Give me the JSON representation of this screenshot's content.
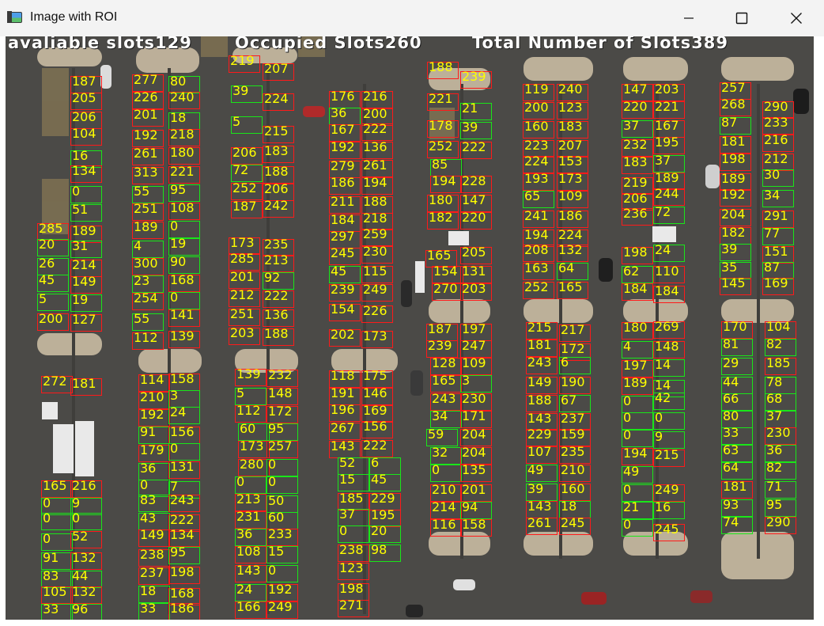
{
  "window": {
    "title": "Image with ROI"
  },
  "overlay": {
    "available": "avaliable slots129",
    "occupied": "Occupied Slots260",
    "total": "Total Number of Slots389"
  },
  "slots": [
    {
      "n": "187",
      "s": "occ"
    },
    {
      "n": "205",
      "s": "occ"
    },
    {
      "n": "206",
      "s": "occ"
    },
    {
      "n": "104",
      "s": "occ"
    },
    {
      "n": "16",
      "s": "free"
    },
    {
      "n": "134",
      "s": "occ"
    },
    {
      "n": "0",
      "s": "free"
    },
    {
      "n": "51",
      "s": "free"
    },
    {
      "n": "285",
      "s": "occ"
    },
    {
      "n": "189",
      "s": "occ"
    },
    {
      "n": "20",
      "s": "free"
    },
    {
      "n": "31",
      "s": "free"
    },
    {
      "n": "26",
      "s": "free"
    },
    {
      "n": "214",
      "s": "occ"
    },
    {
      "n": "45",
      "s": "free"
    },
    {
      "n": "149",
      "s": "occ"
    },
    {
      "n": "5",
      "s": "free"
    },
    {
      "n": "19",
      "s": "free"
    },
    {
      "n": "200",
      "s": "occ"
    },
    {
      "n": "127",
      "s": "occ"
    },
    {
      "n": "272",
      "s": "occ"
    },
    {
      "n": "181",
      "s": "occ"
    },
    {
      "n": "165",
      "s": "occ"
    },
    {
      "n": "216",
      "s": "occ"
    },
    {
      "n": "0",
      "s": "free"
    },
    {
      "n": "9",
      "s": "free"
    },
    {
      "n": "0",
      "s": "free"
    },
    {
      "n": "0",
      "s": "free"
    },
    {
      "n": "0",
      "s": "free"
    },
    {
      "n": "52",
      "s": "occ"
    },
    {
      "n": "91",
      "s": "free"
    },
    {
      "n": "132",
      "s": "occ"
    },
    {
      "n": "83",
      "s": "free"
    },
    {
      "n": "44",
      "s": "free"
    },
    {
      "n": "105",
      "s": "occ"
    },
    {
      "n": "132",
      "s": "occ"
    },
    {
      "n": "33",
      "s": "free"
    },
    {
      "n": "96",
      "s": "free"
    },
    {
      "n": "277",
      "s": "occ"
    },
    {
      "n": "80",
      "s": "free"
    },
    {
      "n": "226",
      "s": "occ"
    },
    {
      "n": "240",
      "s": "occ"
    },
    {
      "n": "201",
      "s": "occ"
    },
    {
      "n": "18",
      "s": "free"
    },
    {
      "n": "192",
      "s": "occ"
    },
    {
      "n": "218",
      "s": "occ"
    },
    {
      "n": "261",
      "s": "occ"
    },
    {
      "n": "180",
      "s": "occ"
    },
    {
      "n": "313",
      "s": "occ"
    },
    {
      "n": "221",
      "s": "occ"
    },
    {
      "n": "55",
      "s": "free"
    },
    {
      "n": "95",
      "s": "free"
    },
    {
      "n": "251",
      "s": "occ"
    },
    {
      "n": "108",
      "s": "occ"
    },
    {
      "n": "189",
      "s": "occ"
    },
    {
      "n": "0",
      "s": "free"
    },
    {
      "n": "4",
      "s": "free"
    },
    {
      "n": "19",
      "s": "free"
    },
    {
      "n": "300",
      "s": "occ"
    },
    {
      "n": "90",
      "s": "free"
    },
    {
      "n": "23",
      "s": "free"
    },
    {
      "n": "168",
      "s": "occ"
    },
    {
      "n": "254",
      "s": "occ"
    },
    {
      "n": "0",
      "s": "free"
    },
    {
      "n": "55",
      "s": "free"
    },
    {
      "n": "141",
      "s": "occ"
    },
    {
      "n": "112",
      "s": "occ"
    },
    {
      "n": "139",
      "s": "occ"
    },
    {
      "n": "114",
      "s": "occ"
    },
    {
      "n": "158",
      "s": "occ"
    },
    {
      "n": "210",
      "s": "occ"
    },
    {
      "n": "3",
      "s": "free"
    },
    {
      "n": "192",
      "s": "occ"
    },
    {
      "n": "24",
      "s": "free"
    },
    {
      "n": "91",
      "s": "free"
    },
    {
      "n": "156",
      "s": "occ"
    },
    {
      "n": "179",
      "s": "occ"
    },
    {
      "n": "0",
      "s": "free"
    },
    {
      "n": "36",
      "s": "free"
    },
    {
      "n": "131",
      "s": "occ"
    },
    {
      "n": "0",
      "s": "free"
    },
    {
      "n": "7",
      "s": "free"
    },
    {
      "n": "83",
      "s": "free"
    },
    {
      "n": "243",
      "s": "occ"
    },
    {
      "n": "43",
      "s": "free"
    },
    {
      "n": "222",
      "s": "occ"
    },
    {
      "n": "149",
      "s": "occ"
    },
    {
      "n": "134",
      "s": "occ"
    },
    {
      "n": "238",
      "s": "occ"
    },
    {
      "n": "95",
      "s": "free"
    },
    {
      "n": "237",
      "s": "occ"
    },
    {
      "n": "198",
      "s": "occ"
    },
    {
      "n": "18",
      "s": "free"
    },
    {
      "n": "168",
      "s": "occ"
    },
    {
      "n": "33",
      "s": "free"
    },
    {
      "n": "186",
      "s": "occ"
    },
    {
      "n": "219",
      "s": "occ"
    },
    {
      "n": "207",
      "s": "occ"
    },
    {
      "n": "39",
      "s": "free"
    },
    {
      "n": "224",
      "s": "occ"
    },
    {
      "n": "5",
      "s": "free"
    },
    {
      "n": "215",
      "s": "occ"
    },
    {
      "n": "206",
      "s": "occ"
    },
    {
      "n": "183",
      "s": "occ"
    },
    {
      "n": "72",
      "s": "free"
    },
    {
      "n": "188",
      "s": "occ"
    },
    {
      "n": "252",
      "s": "occ"
    },
    {
      "n": "206",
      "s": "occ"
    },
    {
      "n": "187",
      "s": "occ"
    },
    {
      "n": "242",
      "s": "occ"
    },
    {
      "n": "173",
      "s": "occ"
    },
    {
      "n": "235",
      "s": "occ"
    },
    {
      "n": "285",
      "s": "occ"
    },
    {
      "n": "213",
      "s": "occ"
    },
    {
      "n": "201",
      "s": "occ"
    },
    {
      "n": "92",
      "s": "free"
    },
    {
      "n": "212",
      "s": "occ"
    },
    {
      "n": "222",
      "s": "occ"
    },
    {
      "n": "251",
      "s": "occ"
    },
    {
      "n": "136",
      "s": "occ"
    },
    {
      "n": "203",
      "s": "occ"
    },
    {
      "n": "188",
      "s": "occ"
    },
    {
      "n": "139",
      "s": "occ"
    },
    {
      "n": "232",
      "s": "occ"
    },
    {
      "n": "5",
      "s": "free"
    },
    {
      "n": "148",
      "s": "occ"
    },
    {
      "n": "112",
      "s": "occ"
    },
    {
      "n": "172",
      "s": "occ"
    },
    {
      "n": "60",
      "s": "free"
    },
    {
      "n": "95",
      "s": "free"
    },
    {
      "n": "173",
      "s": "occ"
    },
    {
      "n": "257",
      "s": "occ"
    },
    {
      "n": "280",
      "s": "occ"
    },
    {
      "n": "0",
      "s": "free"
    },
    {
      "n": "0",
      "s": "free"
    },
    {
      "n": "0",
      "s": "free"
    },
    {
      "n": "213",
      "s": "occ"
    },
    {
      "n": "50",
      "s": "free"
    },
    {
      "n": "231",
      "s": "occ"
    },
    {
      "n": "60",
      "s": "free"
    },
    {
      "n": "36",
      "s": "free"
    },
    {
      "n": "233",
      "s": "occ"
    },
    {
      "n": "108",
      "s": "occ"
    },
    {
      "n": "15",
      "s": "free"
    },
    {
      "n": "143",
      "s": "occ"
    },
    {
      "n": "0",
      "s": "free"
    },
    {
      "n": "24",
      "s": "free"
    },
    {
      "n": "192",
      "s": "occ"
    },
    {
      "n": "166",
      "s": "occ"
    },
    {
      "n": "249",
      "s": "occ"
    },
    {
      "n": "176",
      "s": "occ"
    },
    {
      "n": "216",
      "s": "occ"
    },
    {
      "n": "36",
      "s": "free"
    },
    {
      "n": "200",
      "s": "occ"
    },
    {
      "n": "167",
      "s": "occ"
    },
    {
      "n": "222",
      "s": "occ"
    },
    {
      "n": "192",
      "s": "occ"
    },
    {
      "n": "136",
      "s": "occ"
    },
    {
      "n": "279",
      "s": "occ"
    },
    {
      "n": "261",
      "s": "occ"
    },
    {
      "n": "186",
      "s": "occ"
    },
    {
      "n": "194",
      "s": "occ"
    },
    {
      "n": "211",
      "s": "occ"
    },
    {
      "n": "188",
      "s": "occ"
    },
    {
      "n": "184",
      "s": "occ"
    },
    {
      "n": "218",
      "s": "occ"
    },
    {
      "n": "297",
      "s": "occ"
    },
    {
      "n": "259",
      "s": "occ"
    },
    {
      "n": "245",
      "s": "occ"
    },
    {
      "n": "230",
      "s": "occ"
    },
    {
      "n": "45",
      "s": "free"
    },
    {
      "n": "115",
      "s": "occ"
    },
    {
      "n": "239",
      "s": "occ"
    },
    {
      "n": "249",
      "s": "occ"
    },
    {
      "n": "154",
      "s": "occ"
    },
    {
      "n": "226",
      "s": "occ"
    },
    {
      "n": "202",
      "s": "occ"
    },
    {
      "n": "173",
      "s": "occ"
    },
    {
      "n": "118",
      "s": "occ"
    },
    {
      "n": "175",
      "s": "occ"
    },
    {
      "n": "191",
      "s": "occ"
    },
    {
      "n": "146",
      "s": "occ"
    },
    {
      "n": "196",
      "s": "occ"
    },
    {
      "n": "169",
      "s": "occ"
    },
    {
      "n": "267",
      "s": "occ"
    },
    {
      "n": "156",
      "s": "occ"
    },
    {
      "n": "143",
      "s": "occ"
    },
    {
      "n": "222",
      "s": "occ"
    },
    {
      "n": "52",
      "s": "free"
    },
    {
      "n": "6",
      "s": "free"
    },
    {
      "n": "15",
      "s": "free"
    },
    {
      "n": "45",
      "s": "free"
    },
    {
      "n": "185",
      "s": "occ"
    },
    {
      "n": "229",
      "s": "occ"
    },
    {
      "n": "37",
      "s": "free"
    },
    {
      "n": "195",
      "s": "occ"
    },
    {
      "n": "0",
      "s": "free"
    },
    {
      "n": "20",
      "s": "free"
    },
    {
      "n": "238",
      "s": "occ"
    },
    {
      "n": "98",
      "s": "free"
    },
    {
      "n": "123",
      "s": "occ"
    },
    {
      "n": "198",
      "s": "occ"
    },
    {
      "n": "271",
      "s": "occ"
    },
    {
      "n": "188",
      "s": "occ"
    },
    {
      "n": "239",
      "s": "occ"
    },
    {
      "n": "221",
      "s": "occ"
    },
    {
      "n": "21",
      "s": "free"
    },
    {
      "n": "178",
      "s": "occ"
    },
    {
      "n": "39",
      "s": "free"
    },
    {
      "n": "252",
      "s": "occ"
    },
    {
      "n": "222",
      "s": "occ"
    },
    {
      "n": "85",
      "s": "free"
    },
    {
      "n": "194",
      "s": "occ"
    },
    {
      "n": "228",
      "s": "occ"
    },
    {
      "n": "180",
      "s": "occ"
    },
    {
      "n": "147",
      "s": "occ"
    },
    {
      "n": "182",
      "s": "occ"
    },
    {
      "n": "220",
      "s": "occ"
    },
    {
      "n": "165",
      "s": "occ"
    },
    {
      "n": "205",
      "s": "occ"
    },
    {
      "n": "154",
      "s": "occ"
    },
    {
      "n": "131",
      "s": "occ"
    },
    {
      "n": "270",
      "s": "occ"
    },
    {
      "n": "203",
      "s": "occ"
    },
    {
      "n": "187",
      "s": "occ"
    },
    {
      "n": "197",
      "s": "occ"
    },
    {
      "n": "239",
      "s": "occ"
    },
    {
      "n": "247",
      "s": "occ"
    },
    {
      "n": "128",
      "s": "occ"
    },
    {
      "n": "109",
      "s": "occ"
    },
    {
      "n": "165",
      "s": "occ"
    },
    {
      "n": "3",
      "s": "free"
    },
    {
      "n": "243",
      "s": "occ"
    },
    {
      "n": "230",
      "s": "occ"
    },
    {
      "n": "34",
      "s": "free"
    },
    {
      "n": "171",
      "s": "occ"
    },
    {
      "n": "59",
      "s": "free"
    },
    {
      "n": "204",
      "s": "occ"
    },
    {
      "n": "32",
      "s": "free"
    },
    {
      "n": "204",
      "s": "occ"
    },
    {
      "n": "0",
      "s": "free"
    },
    {
      "n": "135",
      "s": "occ"
    },
    {
      "n": "210",
      "s": "occ"
    },
    {
      "n": "201",
      "s": "occ"
    },
    {
      "n": "214",
      "s": "occ"
    },
    {
      "n": "94",
      "s": "free"
    },
    {
      "n": "116",
      "s": "occ"
    },
    {
      "n": "158",
      "s": "occ"
    },
    {
      "n": "119",
      "s": "occ"
    },
    {
      "n": "240",
      "s": "occ"
    },
    {
      "n": "200",
      "s": "occ"
    },
    {
      "n": "123",
      "s": "occ"
    },
    {
      "n": "160",
      "s": "occ"
    },
    {
      "n": "183",
      "s": "occ"
    },
    {
      "n": "223",
      "s": "occ"
    },
    {
      "n": "207",
      "s": "occ"
    },
    {
      "n": "224",
      "s": "occ"
    },
    {
      "n": "153",
      "s": "occ"
    },
    {
      "n": "193",
      "s": "occ"
    },
    {
      "n": "173",
      "s": "occ"
    },
    {
      "n": "65",
      "s": "free"
    },
    {
      "n": "109",
      "s": "occ"
    },
    {
      "n": "241",
      "s": "occ"
    },
    {
      "n": "186",
      "s": "occ"
    },
    {
      "n": "194",
      "s": "occ"
    },
    {
      "n": "224",
      "s": "occ"
    },
    {
      "n": "208",
      "s": "occ"
    },
    {
      "n": "132",
      "s": "occ"
    },
    {
      "n": "163",
      "s": "occ"
    },
    {
      "n": "64",
      "s": "free"
    },
    {
      "n": "252",
      "s": "occ"
    },
    {
      "n": "165",
      "s": "occ"
    },
    {
      "n": "215",
      "s": "occ"
    },
    {
      "n": "217",
      "s": "occ"
    },
    {
      "n": "181",
      "s": "occ"
    },
    {
      "n": "172",
      "s": "occ"
    },
    {
      "n": "243",
      "s": "occ"
    },
    {
      "n": "6",
      "s": "free"
    },
    {
      "n": "149",
      "s": "occ"
    },
    {
      "n": "190",
      "s": "occ"
    },
    {
      "n": "188",
      "s": "occ"
    },
    {
      "n": "67",
      "s": "free"
    },
    {
      "n": "143",
      "s": "occ"
    },
    {
      "n": "237",
      "s": "occ"
    },
    {
      "n": "229",
      "s": "occ"
    },
    {
      "n": "159",
      "s": "occ"
    },
    {
      "n": "107",
      "s": "occ"
    },
    {
      "n": "235",
      "s": "occ"
    },
    {
      "n": "49",
      "s": "free"
    },
    {
      "n": "210",
      "s": "occ"
    },
    {
      "n": "39",
      "s": "free"
    },
    {
      "n": "160",
      "s": "occ"
    },
    {
      "n": "143",
      "s": "occ"
    },
    {
      "n": "18",
      "s": "free"
    },
    {
      "n": "261",
      "s": "occ"
    },
    {
      "n": "245",
      "s": "occ"
    },
    {
      "n": "147",
      "s": "occ"
    },
    {
      "n": "203",
      "s": "occ"
    },
    {
      "n": "220",
      "s": "occ"
    },
    {
      "n": "221",
      "s": "occ"
    },
    {
      "n": "37",
      "s": "free"
    },
    {
      "n": "167",
      "s": "occ"
    },
    {
      "n": "232",
      "s": "occ"
    },
    {
      "n": "195",
      "s": "occ"
    },
    {
      "n": "183",
      "s": "occ"
    },
    {
      "n": "37",
      "s": "free"
    },
    {
      "n": "219",
      "s": "occ"
    },
    {
      "n": "189",
      "s": "occ"
    },
    {
      "n": "206",
      "s": "occ"
    },
    {
      "n": "244",
      "s": "occ"
    },
    {
      "n": "236",
      "s": "occ"
    },
    {
      "n": "72",
      "s": "free"
    },
    {
      "n": "198",
      "s": "occ"
    },
    {
      "n": "24",
      "s": "free"
    },
    {
      "n": "62",
      "s": "free"
    },
    {
      "n": "110",
      "s": "occ"
    },
    {
      "n": "184",
      "s": "occ"
    },
    {
      "n": "184",
      "s": "occ"
    },
    {
      "n": "180",
      "s": "occ"
    },
    {
      "n": "269",
      "s": "occ"
    },
    {
      "n": "4",
      "s": "free"
    },
    {
      "n": "148",
      "s": "occ"
    },
    {
      "n": "197",
      "s": "occ"
    },
    {
      "n": "14",
      "s": "free"
    },
    {
      "n": "189",
      "s": "occ"
    },
    {
      "n": "14",
      "s": "free"
    },
    {
      "n": "0",
      "s": "free"
    },
    {
      "n": "42",
      "s": "free"
    },
    {
      "n": "0",
      "s": "free"
    },
    {
      "n": "0",
      "s": "free"
    },
    {
      "n": "0",
      "s": "free"
    },
    {
      "n": "9",
      "s": "free"
    },
    {
      "n": "194",
      "s": "occ"
    },
    {
      "n": "215",
      "s": "occ"
    },
    {
      "n": "49",
      "s": "free"
    },
    {
      "n": "0",
      "s": "free"
    },
    {
      "n": "249",
      "s": "occ"
    },
    {
      "n": "21",
      "s": "free"
    },
    {
      "n": "16",
      "s": "free"
    },
    {
      "n": "0",
      "s": "free"
    },
    {
      "n": "245",
      "s": "occ"
    },
    {
      "n": "257",
      "s": "occ"
    },
    {
      "n": "268",
      "s": "occ"
    },
    {
      "n": "290",
      "s": "occ"
    },
    {
      "n": "87",
      "s": "free"
    },
    {
      "n": "233",
      "s": "occ"
    },
    {
      "n": "181",
      "s": "occ"
    },
    {
      "n": "216",
      "s": "occ"
    },
    {
      "n": "198",
      "s": "occ"
    },
    {
      "n": "212",
      "s": "occ"
    },
    {
      "n": "189",
      "s": "occ"
    },
    {
      "n": "30",
      "s": "free"
    },
    {
      "n": "192",
      "s": "occ"
    },
    {
      "n": "34",
      "s": "free"
    },
    {
      "n": "204",
      "s": "occ"
    },
    {
      "n": "291",
      "s": "occ"
    },
    {
      "n": "182",
      "s": "occ"
    },
    {
      "n": "77",
      "s": "free"
    },
    {
      "n": "39",
      "s": "free"
    },
    {
      "n": "151",
      "s": "occ"
    },
    {
      "n": "35",
      "s": "free"
    },
    {
      "n": "87",
      "s": "free"
    },
    {
      "n": "145",
      "s": "occ"
    },
    {
      "n": "169",
      "s": "occ"
    },
    {
      "n": "170",
      "s": "occ"
    },
    {
      "n": "104",
      "s": "occ"
    },
    {
      "n": "81",
      "s": "free"
    },
    {
      "n": "82",
      "s": "free"
    },
    {
      "n": "29",
      "s": "free"
    },
    {
      "n": "185",
      "s": "occ"
    },
    {
      "n": "44",
      "s": "free"
    },
    {
      "n": "78",
      "s": "free"
    },
    {
      "n": "66",
      "s": "free"
    },
    {
      "n": "68",
      "s": "free"
    },
    {
      "n": "80",
      "s": "free"
    },
    {
      "n": "37",
      "s": "free"
    },
    {
      "n": "33",
      "s": "free"
    },
    {
      "n": "230",
      "s": "occ"
    },
    {
      "n": "63",
      "s": "free"
    },
    {
      "n": "36",
      "s": "free"
    },
    {
      "n": "64",
      "s": "free"
    },
    {
      "n": "82",
      "s": "free"
    },
    {
      "n": "181",
      "s": "occ"
    },
    {
      "n": "71",
      "s": "free"
    },
    {
      "n": "93",
      "s": "free"
    },
    {
      "n": "95",
      "s": "free"
    },
    {
      "n": "74",
      "s": "free"
    },
    {
      "n": "290",
      "s": "occ"
    },
    {
      "n": "207",
      "s": "occ"
    }
  ]
}
